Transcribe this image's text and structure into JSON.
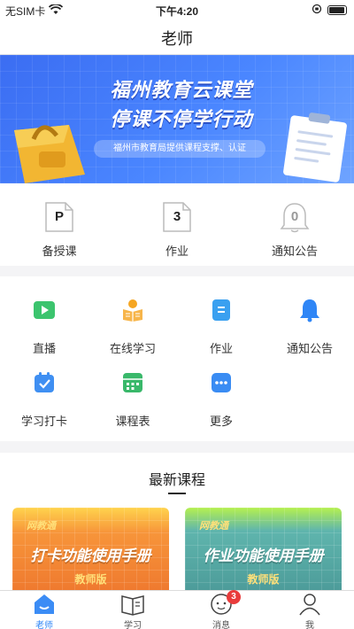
{
  "status_bar": {
    "carrier": "无SIM卡",
    "time": "下午4:20"
  },
  "nav": {
    "title": "老师"
  },
  "banner": {
    "title_line1": "福州教育云课堂",
    "title_line2": "停课不停学行动",
    "subtitle": "福州市教育局提供课程支撑、认证",
    "page_count": 2,
    "active_page": 0
  },
  "summary": [
    {
      "value": "P",
      "label": "备授课"
    },
    {
      "value": "3",
      "label": "作业"
    },
    {
      "value": "0",
      "label": "通知公告"
    }
  ],
  "features": [
    {
      "label": "直播",
      "icon": "live-tv-icon"
    },
    {
      "label": "在线学习",
      "icon": "online-study-icon"
    },
    {
      "label": "作业",
      "icon": "homework-icon"
    },
    {
      "label": "通知公告",
      "icon": "bell-icon"
    },
    {
      "label": "学习打卡",
      "icon": "calendar-check-icon"
    },
    {
      "label": "课程表",
      "icon": "timetable-icon"
    },
    {
      "label": "更多",
      "icon": "more-icon"
    }
  ],
  "courses": {
    "heading": "最新课程",
    "cards": [
      {
        "brand": "网教通",
        "title": "打卡功能使用手册",
        "edition": "教师版",
        "theme": "orange"
      },
      {
        "brand": "网教通",
        "title": "作业功能使用手册",
        "edition": "教师版",
        "theme": "teal"
      }
    ]
  },
  "tab_bar": {
    "tabs": [
      {
        "label": "老师",
        "active": true
      },
      {
        "label": "学习",
        "active": false
      },
      {
        "label": "消息",
        "active": false,
        "badge": "3"
      },
      {
        "label": "我",
        "active": false
      }
    ]
  },
  "colors": {
    "accent": "#2f86f6",
    "badge": "#e93c3c",
    "banner": "#4a86ff"
  }
}
